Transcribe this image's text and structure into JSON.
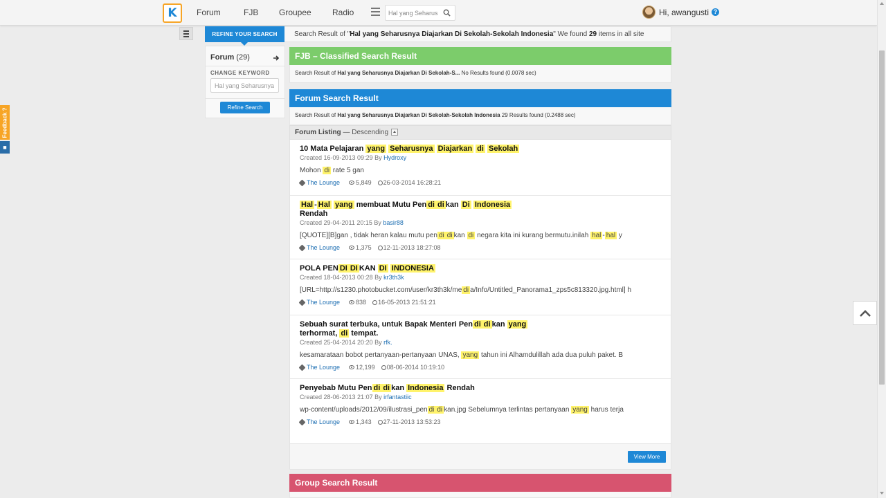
{
  "nav": {
    "logo": "K",
    "items": [
      "Forum",
      "FJB",
      "Groupee",
      "Radio"
    ],
    "search_placeholder": "Hal yang Seharusnya Diajarkan Di Sekolah-Sekolah Indonesia",
    "greeting": "Hi, awangusti",
    "help": "?"
  },
  "feedback": {
    "label": "Feedback ?"
  },
  "refine": {
    "tab_label": "REFINE YOUR SEARCH",
    "forum_label": "Forum",
    "forum_count": "(29)",
    "change_keyword": "CHANGE KEYWORD",
    "keyword_value": "Hal yang Seharusnya Diajarkan Di Sekolah-Sekolah Indonesia",
    "button": "Refine Search"
  },
  "result_header": {
    "prefix": "Search Result of \"",
    "query": "Hal yang Seharusnya Diajarkan Di Sekolah-Sekolah Indonesia",
    "middle": "\" We found ",
    "count": "29",
    "suffix": " items in all site"
  },
  "fjb": {
    "title": "FJB – Classified Search Result",
    "info_prefix": "Search Result of ",
    "info_query": "Hal yang Seharusnya Diajarkan Di Sekolah-S...",
    "info_suffix": "  No Results found (0.0078 sec)"
  },
  "forum": {
    "title": "Forum Search Result",
    "info_prefix": "Search Result of ",
    "info_query": "Hal yang Seharusnya Diajarkan Di Sekolah-Sekolah Indonesia",
    "info_suffix": " 29 Results found (0.2488 sec)",
    "listing_label": "Forum Listing",
    "listing_order": " — Descending",
    "view_more": "View More"
  },
  "group": {
    "title": "Group Search Result"
  },
  "threads": [
    {
      "title_parts": [
        [
          "10 Mata Pelajaran ",
          0
        ],
        [
          "yang",
          1
        ],
        [
          " ",
          0
        ],
        [
          "Seharusnya",
          1
        ],
        [
          " ",
          0
        ],
        [
          "Diajarkan",
          1
        ],
        [
          " ",
          0
        ],
        [
          "di",
          1
        ],
        [
          " ",
          0
        ],
        [
          "Sekolah",
          1
        ]
      ],
      "created": "Created 16-09-2013 09:29 By ",
      "author": "Hydroxy",
      "excerpt_parts": [
        [
          "Mohon ",
          0
        ],
        [
          "di",
          1
        ],
        [
          " rate 5 gan",
          0
        ]
      ],
      "category": "The Lounge",
      "views": "5,849",
      "last_post": "26-03-2014 16:28:21"
    },
    {
      "title_parts": [
        [
          "Hal",
          1
        ],
        [
          "-",
          0
        ],
        [
          "Hal",
          1
        ],
        [
          " ",
          0
        ],
        [
          "yang",
          1
        ],
        [
          " membuat Mutu Pen",
          0
        ],
        [
          "di",
          1
        ],
        [
          "di",
          1
        ],
        [
          "kan ",
          0
        ],
        [
          "Di",
          1
        ],
        [
          " ",
          0
        ],
        [
          "Indonesia",
          1
        ],
        [
          "\nRendah",
          0
        ]
      ],
      "created": "Created 29-04-2011 20:15 By ",
      "author": "basir88",
      "excerpt_parts": [
        [
          "[QUOTE][B]gan , tidak heran kalau mutu pen",
          0
        ],
        [
          "di",
          1
        ],
        [
          "di",
          1
        ],
        [
          "kan ",
          0
        ],
        [
          "di",
          1
        ],
        [
          " negara kita ini kurang bermutu.inilah ",
          0
        ],
        [
          "hal",
          1
        ],
        [
          "-",
          0
        ],
        [
          "hal",
          1
        ],
        [
          " y",
          0
        ]
      ],
      "category": "The Lounge",
      "views": "1,375",
      "last_post": "12-11-2013 18:27:08"
    },
    {
      "title_parts": [
        [
          "POLA PEN",
          0
        ],
        [
          "DI",
          1
        ],
        [
          "DI",
          1
        ],
        [
          "KAN ",
          0
        ],
        [
          "DI",
          1
        ],
        [
          " ",
          0
        ],
        [
          "INDONESIA",
          1
        ]
      ],
      "created": "Created 18-04-2013 00:28 By ",
      "author": "kr3th3k",
      "excerpt_parts": [
        [
          "[URL=http://s1230.photobucket.com/user/kr3th3k/me",
          0
        ],
        [
          "di",
          1
        ],
        [
          "a/Info/Untitled_Panorama1_zps5c813320.jpg.html] h",
          0
        ]
      ],
      "category": "The Lounge",
      "views": "838",
      "last_post": "16-05-2013 21:51:21"
    },
    {
      "title_parts": [
        [
          "Sebuah surat terbuka, untuk Bapak Menteri Pen",
          0
        ],
        [
          "di",
          1
        ],
        [
          "di",
          1
        ],
        [
          "kan ",
          0
        ],
        [
          "yang",
          1
        ],
        [
          "\nterhormat, ",
          0
        ],
        [
          "di",
          1
        ],
        [
          " tempat.",
          0
        ]
      ],
      "created": "Created 25-04-2014 20:20 By ",
      "author": "rfk.",
      "excerpt_parts": [
        [
          "kesamarataan bobot pertanyaan-pertanyaan UNAS, ",
          0
        ],
        [
          "yang",
          1
        ],
        [
          " tahun ini Alhamdulillah ada dua puluh paket. B",
          0
        ]
      ],
      "category": "The Lounge",
      "views": "12,199",
      "last_post": "08-06-2014 10:19:10"
    },
    {
      "title_parts": [
        [
          "Penyebab Mutu Pen",
          0
        ],
        [
          "di",
          1
        ],
        [
          "di",
          1
        ],
        [
          "kan ",
          0
        ],
        [
          "Indonesia",
          1
        ],
        [
          " Rendah",
          0
        ]
      ],
      "created": "Created 28-06-2013 21:07 By ",
      "author": "irfantastiic",
      "excerpt_parts": [
        [
          "wp-content/uploads/2012/09/ilustrasi_pen",
          0
        ],
        [
          "di",
          1
        ],
        [
          "di",
          1
        ],
        [
          "kan.jpg Sebelumnya terlintas pertanyaan ",
          0
        ],
        [
          "yang",
          1
        ],
        [
          " harus terja",
          0
        ]
      ],
      "category": "The Lounge",
      "views": "1,343",
      "last_post": "27-11-2013 13:53:23"
    }
  ],
  "colors": {
    "primary": "#1e88d6",
    "fjb_green": "#7ccc6b",
    "group_red": "#d7546f",
    "highlight": "#fff36b",
    "feedback_orange": "#f7a526"
  },
  "icons": [
    "kaskus-logo-icon",
    "menu-icon",
    "search-icon",
    "help-icon",
    "sidebar-toggle-icon",
    "chevron-right-icon",
    "sort-asc-icon",
    "tag-icon",
    "eye-icon",
    "clock-icon",
    "back-to-top-icon"
  ]
}
